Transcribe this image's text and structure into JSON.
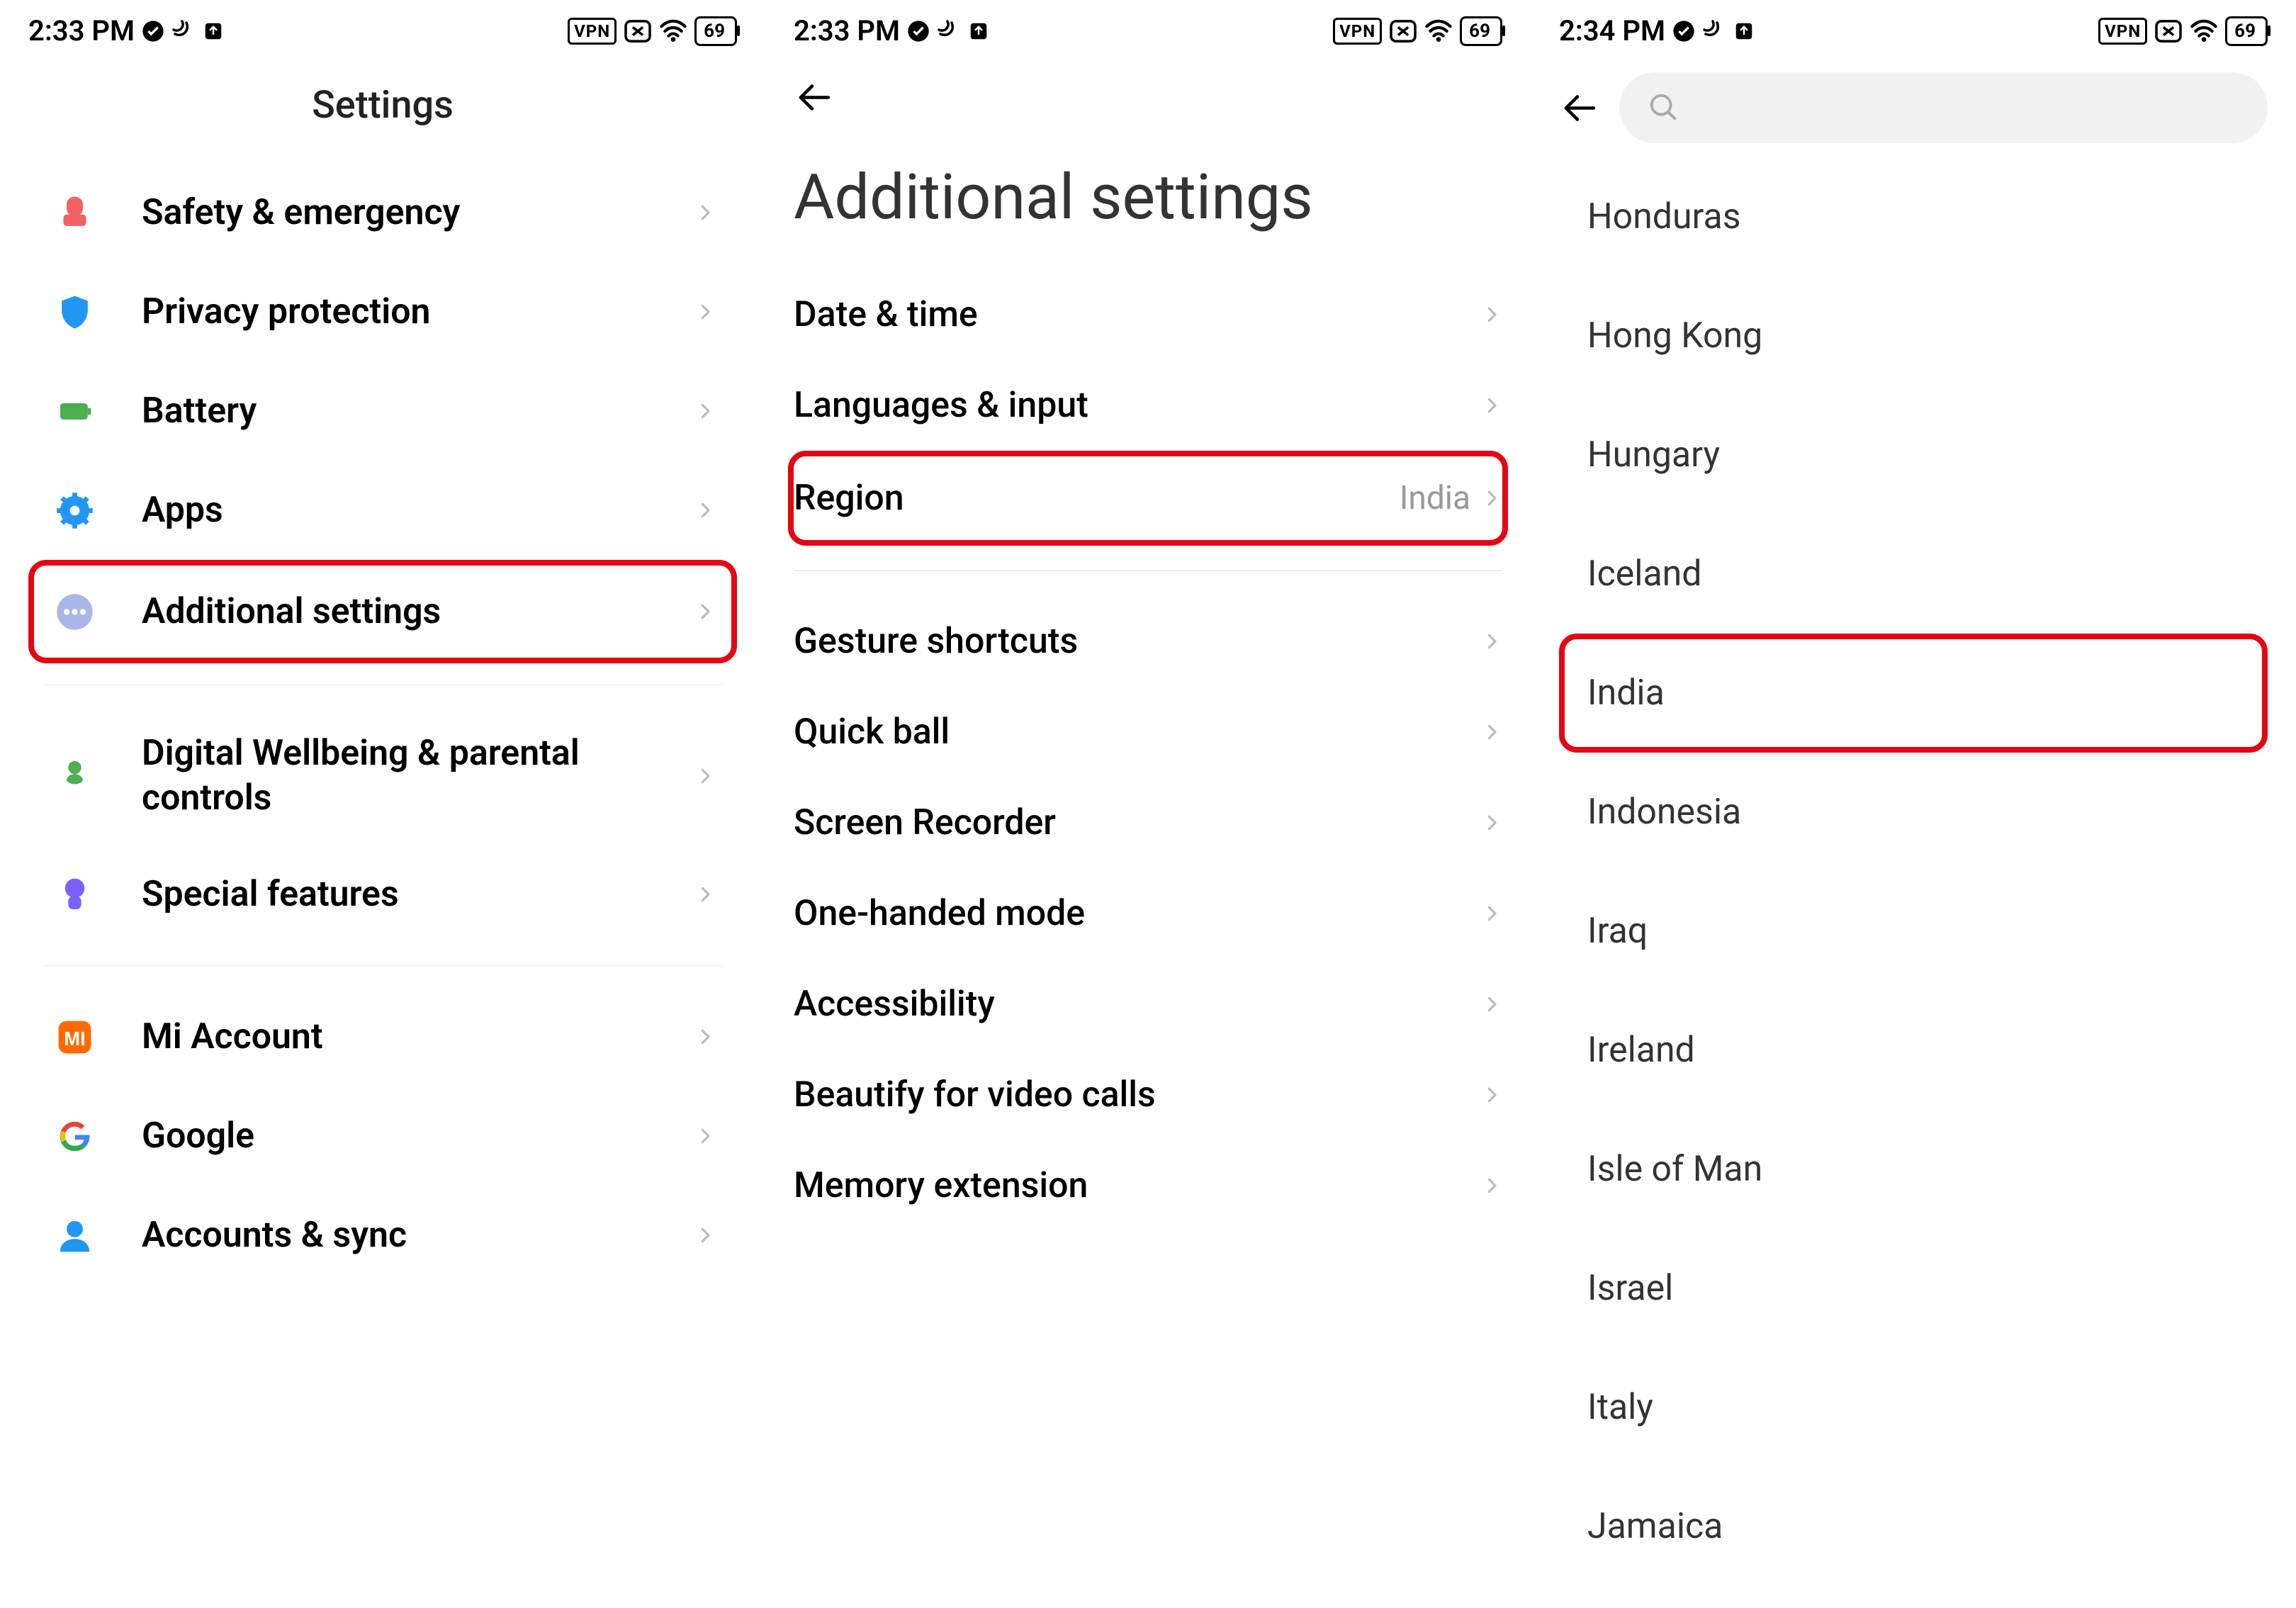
{
  "screens": [
    {
      "status": {
        "time": "2:33 PM",
        "battery": "69",
        "vpn": "VPN"
      },
      "title": "Settings",
      "items": [
        {
          "label": "Safety & emergency",
          "icon": "safety",
          "color": "#f06262",
          "highlight": false
        },
        {
          "label": "Privacy protection",
          "icon": "shield",
          "color": "#2196f3",
          "highlight": false
        },
        {
          "label": "Battery",
          "icon": "battery",
          "color": "#4caf50",
          "highlight": false
        },
        {
          "label": "Apps",
          "icon": "gear",
          "color": "#2196f3",
          "highlight": false
        },
        {
          "label": "Additional settings",
          "icon": "dots",
          "color": "#a9b7e8",
          "highlight": true
        }
      ],
      "items2": [
        {
          "label": "Digital Wellbeing & parental controls",
          "icon": "wellbeing",
          "color": "#4caf50"
        },
        {
          "label": "Special features",
          "icon": "special",
          "color": "#7b61ff"
        }
      ],
      "items3": [
        {
          "label": "Mi Account",
          "icon": "mi",
          "color": "#ff6a00"
        },
        {
          "label": "Google",
          "icon": "google",
          "color": "#4285f4"
        },
        {
          "label": "Accounts & sync",
          "icon": "person",
          "color": "#2196f3"
        }
      ]
    },
    {
      "status": {
        "time": "2:33 PM",
        "battery": "69",
        "vpn": "VPN"
      },
      "title": "Additional settings",
      "items": [
        {
          "label": "Date & time",
          "value": "",
          "highlight": false
        },
        {
          "label": "Languages & input",
          "value": "",
          "highlight": false
        },
        {
          "label": "Region",
          "value": "India",
          "highlight": true
        }
      ],
      "items2": [
        {
          "label": "Gesture shortcuts"
        },
        {
          "label": "Quick ball"
        },
        {
          "label": "Screen Recorder"
        },
        {
          "label": "One-handed mode"
        },
        {
          "label": "Accessibility"
        },
        {
          "label": "Beautify for video calls"
        },
        {
          "label": "Memory extension"
        }
      ]
    },
    {
      "status": {
        "time": "2:34 PM",
        "battery": "69",
        "vpn": "VPN"
      },
      "regions": [
        {
          "name": "Honduras",
          "highlight": false
        },
        {
          "name": "Hong Kong",
          "highlight": false
        },
        {
          "name": "Hungary",
          "highlight": false
        },
        {
          "name": "Iceland",
          "highlight": false
        },
        {
          "name": "India",
          "highlight": true
        },
        {
          "name": "Indonesia",
          "highlight": false
        },
        {
          "name": "Iraq",
          "highlight": false
        },
        {
          "name": "Ireland",
          "highlight": false
        },
        {
          "name": "Isle of Man",
          "highlight": false
        },
        {
          "name": "Israel",
          "highlight": false
        },
        {
          "name": "Italy",
          "highlight": false
        },
        {
          "name": "Jamaica",
          "highlight": false
        }
      ]
    }
  ]
}
